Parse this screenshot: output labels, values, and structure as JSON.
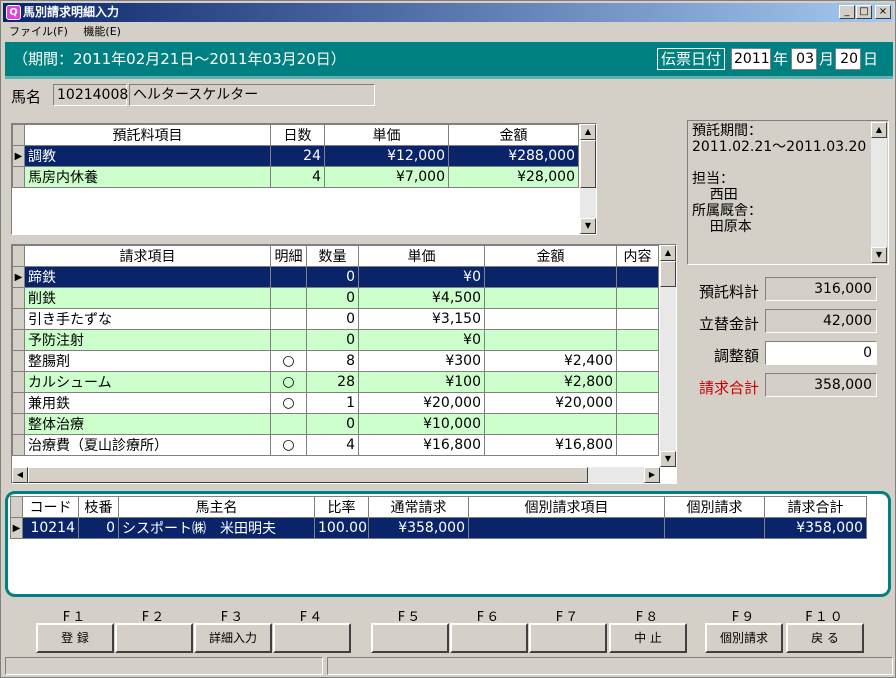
{
  "window": {
    "title": "馬別請求明細入力",
    "icon": "Q"
  },
  "menu": [
    "ファイル(F)",
    "機能(E)"
  ],
  "period": "（期間：2011年02月21日～2011年03月20日）",
  "slip_date": {
    "label": "伝票日付",
    "year": "2011",
    "year_suffix": "年",
    "month": "03",
    "month_suffix": "月",
    "day": "20",
    "day_suffix": "日"
  },
  "horse": {
    "label": "馬名",
    "code": "10214008",
    "name": "ヘルタースケルター"
  },
  "deposit_table": {
    "headers": [
      "預託料項目",
      "日数",
      "単価",
      "金額"
    ],
    "rows": [
      {
        "item": "調教",
        "days": "24",
        "unit": "¥12,000",
        "amount": "¥288,000"
      },
      {
        "item": "馬房内休養",
        "days": "4",
        "unit": "¥7,000",
        "amount": "¥28,000"
      }
    ]
  },
  "billing_table": {
    "headers": [
      "請求項目",
      "明細",
      "数量",
      "単価",
      "金額",
      "内容"
    ],
    "rows": [
      {
        "item": "蹄鉄",
        "detail": "",
        "qty": "0",
        "unit": "¥0",
        "amount": ""
      },
      {
        "item": "削鉄",
        "detail": "",
        "qty": "0",
        "unit": "¥4,500",
        "amount": ""
      },
      {
        "item": "引き手たずな",
        "detail": "",
        "qty": "0",
        "unit": "¥3,150",
        "amount": ""
      },
      {
        "item": "予防注射",
        "detail": "",
        "qty": "0",
        "unit": "¥0",
        "amount": ""
      },
      {
        "item": "整腸剤",
        "detail": "○",
        "qty": "8",
        "unit": "¥300",
        "amount": "¥2,400"
      },
      {
        "item": "カルシューム",
        "detail": "○",
        "qty": "28",
        "unit": "¥100",
        "amount": "¥2,800"
      },
      {
        "item": "兼用鉄",
        "detail": "○",
        "qty": "1",
        "unit": "¥20,000",
        "amount": "¥20,000"
      },
      {
        "item": "整体治療",
        "detail": "",
        "qty": "0",
        "unit": "¥10,000",
        "amount": ""
      },
      {
        "item": "治療費（夏山診療所）",
        "detail": "○",
        "qty": "4",
        "unit": "¥16,800",
        "amount": "¥16,800"
      }
    ]
  },
  "memo": "預託期間：\n2011.02.21～2011.03.20\n\n担当：\n    西田\n所属厩舎：\n    田原本",
  "totals": {
    "deposit_label": "預託料計",
    "deposit_value": "316,000",
    "advance_label": "立替金計",
    "advance_value": "42,000",
    "adjust_label": "調整額",
    "adjust_value": "0",
    "total_label": "請求合計",
    "total_value": "358,000"
  },
  "owner_table": {
    "headers": [
      "コード",
      "枝番",
      "馬主名",
      "比率",
      "通常請求",
      "個別請求項目",
      "個別請求",
      "請求合計"
    ],
    "rows": [
      {
        "code": "10214",
        "branch": "0",
        "owner": "シスポート㈱　米田明夫",
        "ratio": "100.00",
        "normal": "¥358,000",
        "item": "",
        "individual": "",
        "total": "¥358,000"
      }
    ]
  },
  "fkeys": [
    "F１",
    "F２",
    "F３",
    "F４",
    "F５",
    "F６",
    "F７",
    "F８",
    "F９",
    "F１０"
  ],
  "fbuttons": [
    "登 録",
    "",
    "詳細入力",
    "",
    "",
    "",
    "",
    "中 止",
    "個別請求",
    "戻 る"
  ],
  "colors": {
    "teal": "#008080",
    "selected": "#0a246a",
    "row_green": "#ccffcc",
    "total_red": "#cc0000"
  }
}
